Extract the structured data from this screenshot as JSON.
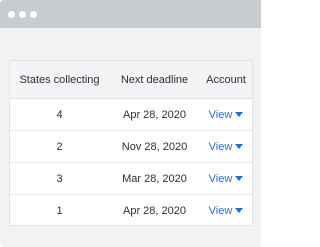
{
  "table": {
    "headers": [
      "States collecting",
      "Next deadline",
      "Account"
    ],
    "rows": [
      {
        "states": "4",
        "deadline": "Apr 28, 2020",
        "account": "View"
      },
      {
        "states": "2",
        "deadline": "Nov 28, 2020",
        "account": "View"
      },
      {
        "states": "3",
        "deadline": "Mar 28, 2020",
        "account": "View"
      },
      {
        "states": "1",
        "deadline": "Apr 28, 2020",
        "account": "View"
      }
    ]
  },
  "icons": {
    "window_controls": "window-dot-icon",
    "dropdown": "caret-down-icon"
  },
  "colors": {
    "link": "#1d73c9",
    "titlebar": "#c9ccd1",
    "header_bg": "#f3f4f6"
  }
}
